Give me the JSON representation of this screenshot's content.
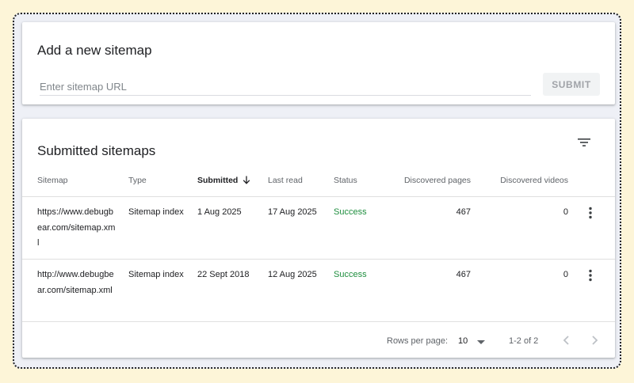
{
  "add_sitemap": {
    "title": "Add a new sitemap",
    "input_placeholder": "Enter sitemap URL",
    "input_value": "",
    "submit_label": "SUBMIT"
  },
  "submitted": {
    "title": "Submitted sitemaps",
    "columns": [
      "Sitemap",
      "Type",
      "Submitted",
      "Last read",
      "Status",
      "Discovered pages",
      "Discovered videos"
    ],
    "sorted_column": "Submitted",
    "sort_direction": "descending",
    "rows": [
      {
        "sitemap": "https://www.debugbear.com/sitemap.xml",
        "type": "Sitemap index",
        "submitted": "1 Aug 2025",
        "last_read": "17 Aug 2025",
        "status": "Success",
        "pages": "467",
        "videos": "0"
      },
      {
        "sitemap": "http://www.debugbear.com/sitemap.xml",
        "type": "Sitemap index",
        "submitted": "22 Sept 2018",
        "last_read": "12 Aug 2025",
        "status": "Success",
        "pages": "467",
        "videos": "0"
      }
    ],
    "footer": {
      "rows_per_page_label": "Rows per page:",
      "rows_per_page_value": "10",
      "range": "1-2 of 2"
    }
  },
  "colors": {
    "page_background": "#fdf5d8",
    "success": "#1e8e3e"
  },
  "icons": {
    "filter": "filter-icon",
    "sort": "arrow-down-icon",
    "more": "more-vert-icon",
    "prev": "chevron-left-icon",
    "next": "chevron-right-icon"
  }
}
